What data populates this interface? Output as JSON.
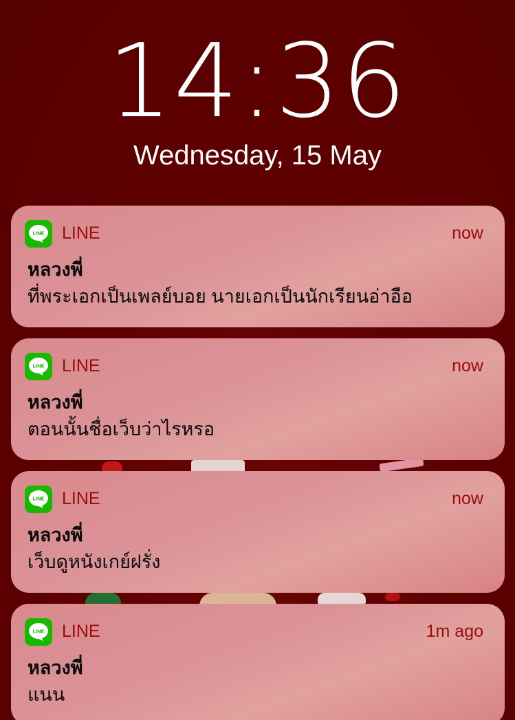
{
  "lock_screen": {
    "time": "14:36",
    "date": "Wednesday, 15 May"
  },
  "notifications": [
    {
      "app": "LINE",
      "app_icon": "line-app-icon",
      "time": "now",
      "sender": "หลวงพี่",
      "message": "ที่พระเอกเป็นเพลย์บอย นายเอกเป็นนักเรียนอ่าอือ"
    },
    {
      "app": "LINE",
      "app_icon": "line-app-icon",
      "time": "now",
      "sender": "หลวงพี่",
      "message": "ตอนนั้นชื่อเว็บว่าไรหรอ"
    },
    {
      "app": "LINE",
      "app_icon": "line-app-icon",
      "time": "now",
      "sender": "หลวงพี่",
      "message": "เว็บดูหนังเกย์ฝรั่ง"
    },
    {
      "app": "LINE",
      "app_icon": "line-app-icon",
      "time": "1m ago",
      "sender": "หลวงพี่",
      "message": "แนน"
    }
  ],
  "icon_text": "LINE",
  "colors": {
    "wallpaper": "#5c0000",
    "line_green": "#18b900",
    "app_label": "#9c0a0a"
  }
}
